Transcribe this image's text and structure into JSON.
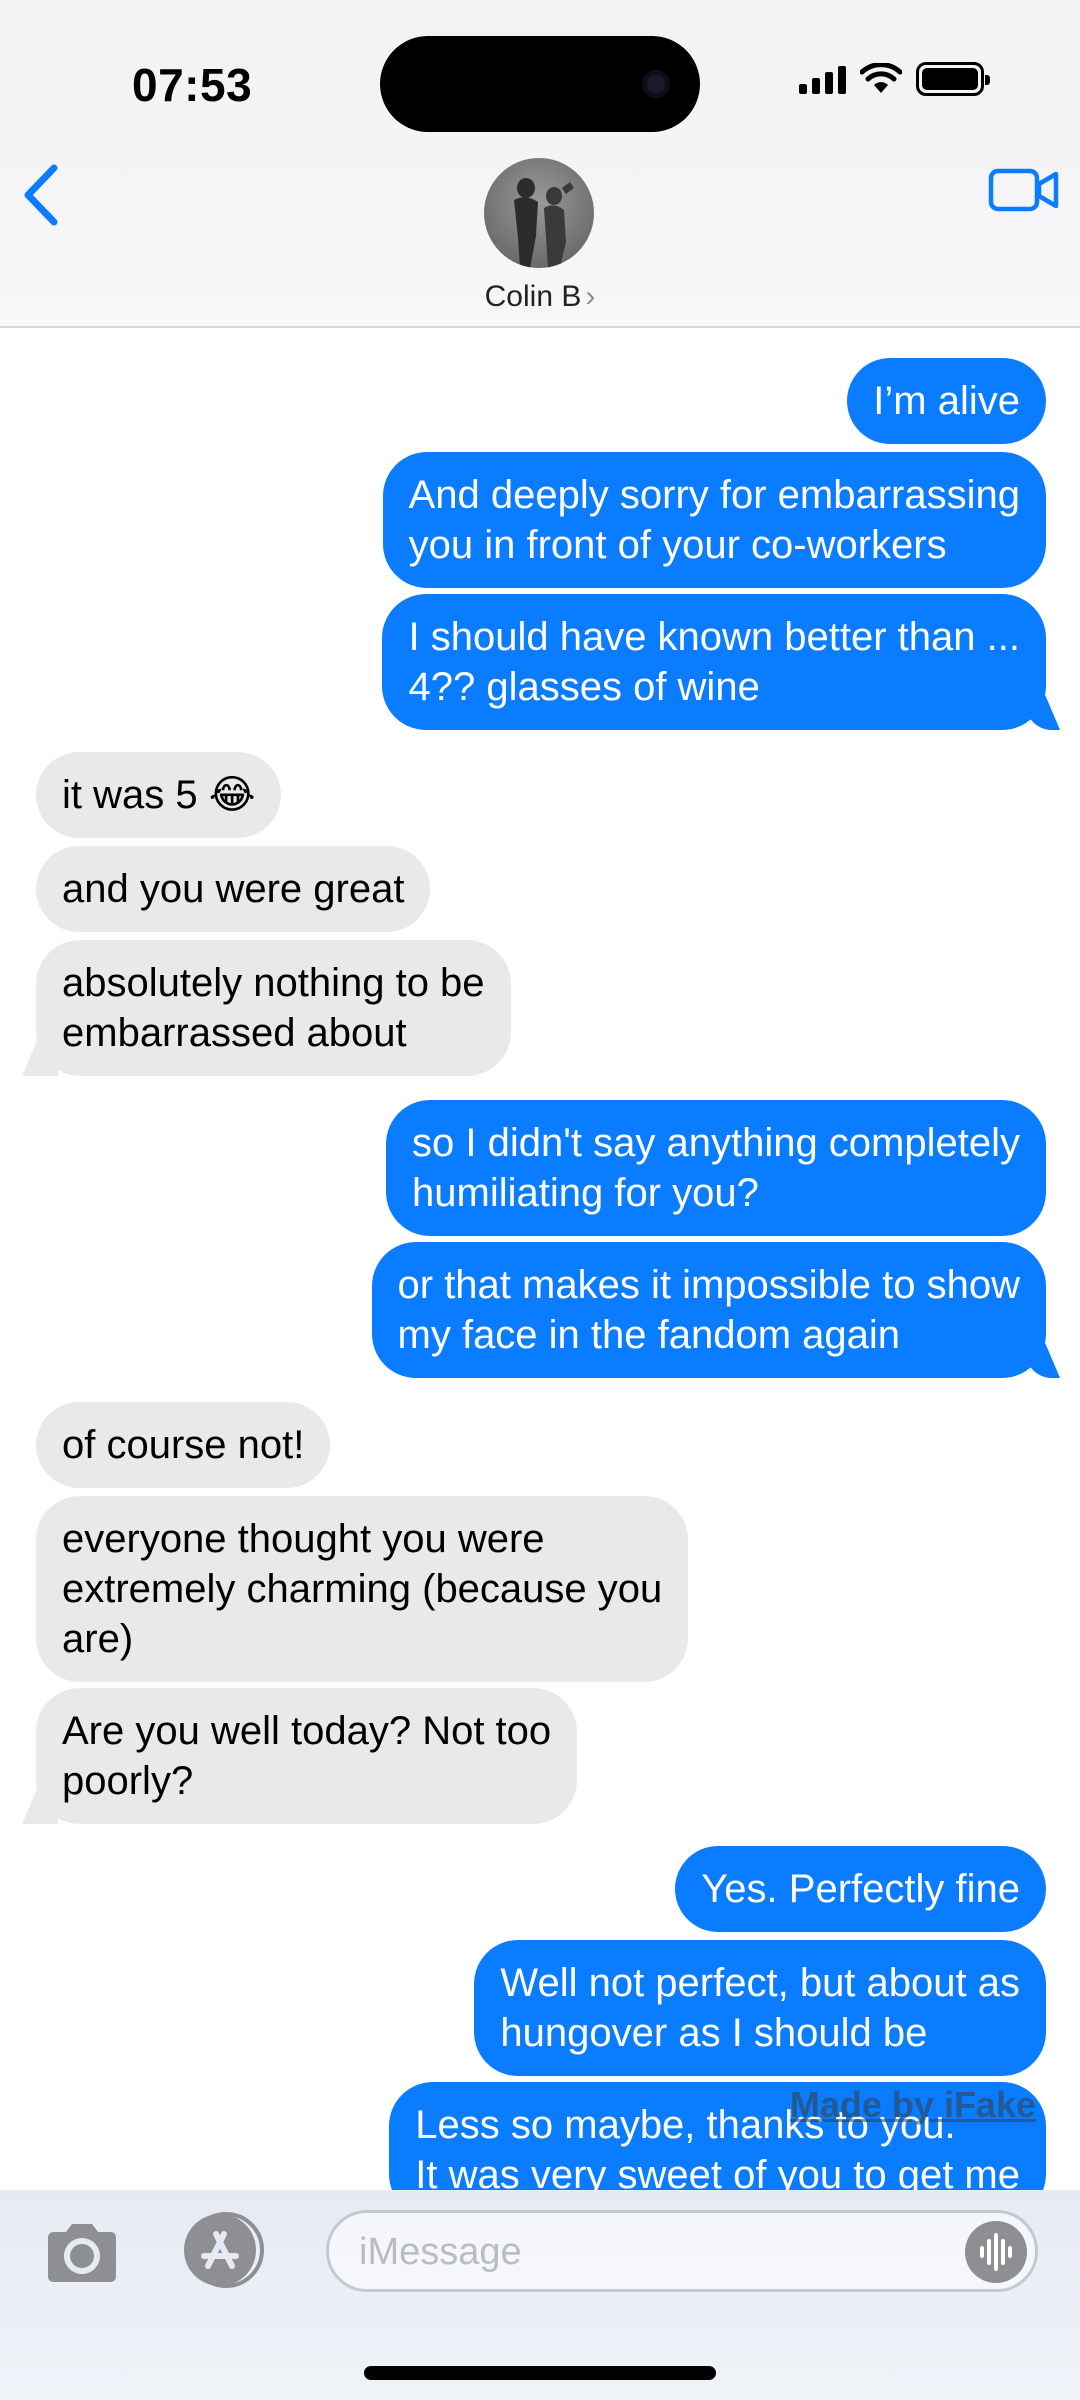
{
  "status_bar": {
    "time": "07:53"
  },
  "header": {
    "contact_name": "Colin B",
    "chevron": "›"
  },
  "messages": [
    {
      "dir": "out",
      "text": "I’m alive"
    },
    {
      "dir": "out",
      "text": "And deeply sorry for embarrassing\nyou in front of your co-workers"
    },
    {
      "dir": "out",
      "text": "I should have known better than ...\n4?? glasses of wine"
    },
    {
      "dir": "in",
      "text": "it was 5 😂"
    },
    {
      "dir": "in",
      "text": "and you were great"
    },
    {
      "dir": "in",
      "text": "absolutely nothing to be\nembarrassed about"
    },
    {
      "dir": "out",
      "text": "so I didn't say anything completely\nhumiliating for you?"
    },
    {
      "dir": "out",
      "text": "or that makes it impossible to show\nmy face in the fandom again"
    },
    {
      "dir": "in",
      "text": "of course not!"
    },
    {
      "dir": "in",
      "text": "everyone thought you were\nextremely charming (because you\nare)"
    },
    {
      "dir": "in",
      "text": "Are you well today? Not too\npoorly?"
    },
    {
      "dir": "out",
      "text": "Yes. Perfectly fine"
    },
    {
      "dir": "out",
      "text": "Well not perfect, but about as\nhungover as I should be"
    },
    {
      "dir": "out",
      "text": "Less so maybe, thanks to you.\nIt was very sweet of you to get me"
    }
  ],
  "watermark": "Made by iFake",
  "compose": {
    "placeholder": "iMessage"
  },
  "colors": {
    "outgoing": "#0a7cff",
    "incoming": "#e9e9eb",
    "accent": "#0a7cff"
  },
  "icons": [
    "chevron-left-icon",
    "video-camera-icon",
    "camera-icon",
    "app-store-icon",
    "audio-waveform-icon"
  ]
}
